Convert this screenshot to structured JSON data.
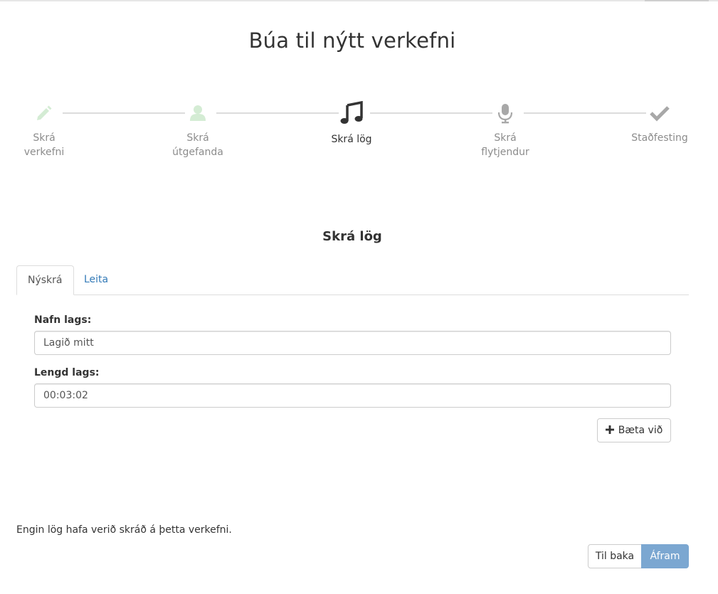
{
  "page": {
    "title": "Búa til nýtt verkefni"
  },
  "wizard": {
    "steps": [
      {
        "label_line1": "Skrá",
        "label_line2": "verkefni",
        "icon": "pencil-icon",
        "state": "done",
        "color": "#d4ecd4"
      },
      {
        "label_line1": "Skrá",
        "label_line2": "útgefanda",
        "icon": "user-icon",
        "state": "done",
        "color": "#d4ecd4"
      },
      {
        "label_line1": "Skrá lög",
        "label_line2": "",
        "icon": "music-icon",
        "state": "active",
        "color": "#333333"
      },
      {
        "label_line1": "Skrá",
        "label_line2": "flytjendur",
        "icon": "microphone-icon",
        "state": "upcoming",
        "color": "#a8a8a8"
      },
      {
        "label_line1": "Staðfesting",
        "label_line2": "",
        "icon": "check-icon",
        "state": "upcoming",
        "color": "#a8a8a8"
      }
    ]
  },
  "section": {
    "title": "Skrá lög"
  },
  "tabs": [
    {
      "label": "Nýskrá",
      "active": true
    },
    {
      "label": "Leita",
      "active": false
    }
  ],
  "form": {
    "song_name": {
      "label": "Nafn lags:",
      "value": "Lagið mitt"
    },
    "song_length": {
      "label": "Lengd lags:",
      "value": "00:03:02"
    },
    "add_button": {
      "label": "Bæta við",
      "icon": "plus-icon"
    }
  },
  "status": {
    "empty_text": "Engin lög hafa verið skráð á þetta verkefni."
  },
  "nav": {
    "back_label": "Til baka",
    "next_label": "Áfram"
  },
  "colors": {
    "accent": "#7ba7d1",
    "link": "#337ab7",
    "done_icon": "#d4ecd4",
    "upcoming_icon": "#a8a8a8"
  }
}
